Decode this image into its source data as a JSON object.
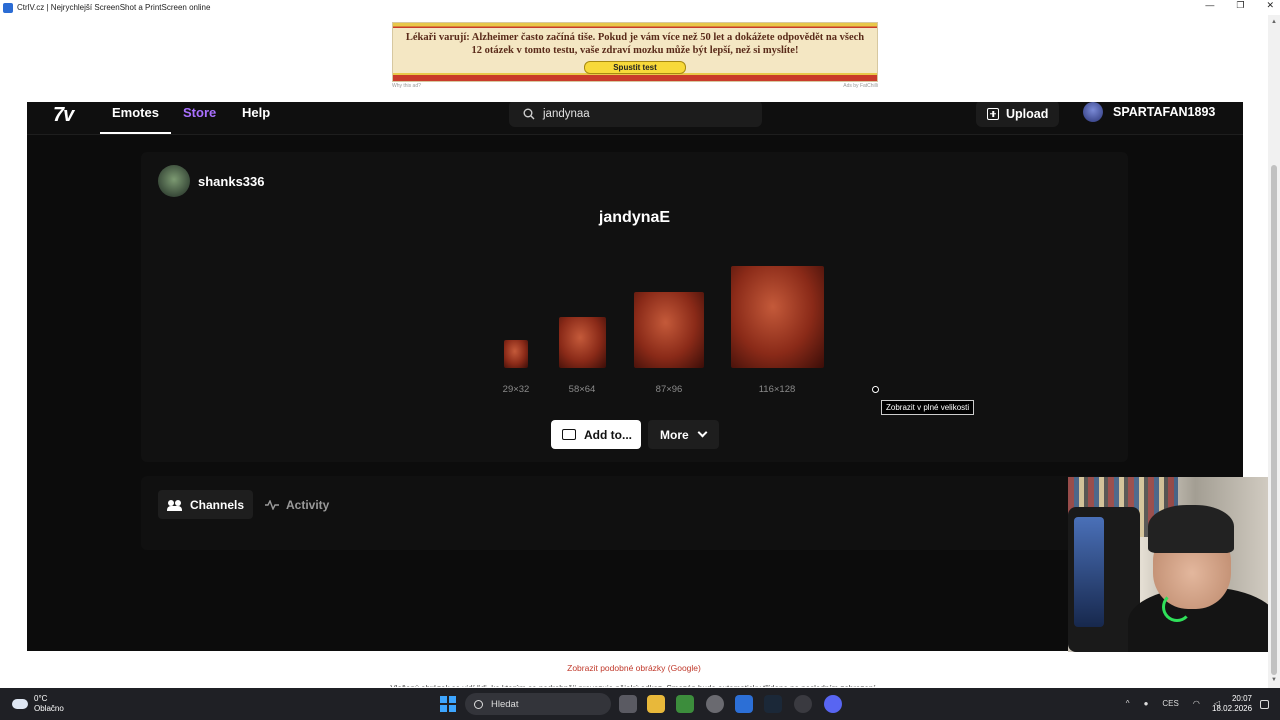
{
  "window": {
    "title": "CtrlV.cz | Nejrychlejší ScreenShot a PrintScreen online",
    "controls": [
      "—",
      "❐",
      "✕"
    ]
  },
  "ad": {
    "text": "Lékaři varují: Alzheimer často začíná tiše. Pokud je vám více než 50 let a dokážete odpovědět na všech 12 otázek v tomto testu, vaše zdraví mozku může být lepší, než si myslíte!",
    "button": "Spustit test",
    "why": "Why this ad?",
    "ads_by": "Ads by FatChilli"
  },
  "nav": {
    "logo": "7v",
    "links": [
      "Emotes",
      "Store",
      "Help"
    ],
    "active": "Emotes",
    "store_color": "#a970ff",
    "search_value": "jandynaa",
    "upload_label": "Upload",
    "username": "SPARTAFAN1893"
  },
  "emote": {
    "owner": "shanks336",
    "name": "jandynaE",
    "sizes": [
      "29×32",
      "58×64",
      "87×96",
      "116×128"
    ],
    "tooltip": "Zobrazit v plné velikosti",
    "add_label": "Add to...",
    "more_label": "More"
  },
  "tabs": {
    "channels": "Channels",
    "activity": "Activity"
  },
  "page": {
    "google_link": "Zobrazit podobné obrázky (Google)",
    "cut_text": "Vložený obrázek se vidí lidi, ke kterým se podrobněji provazuje nějaký odkaz. Smazán bude automaticky třídeno po posledním zobrazení."
  },
  "taskbar": {
    "temp": "0°C",
    "weather": "Oblačno",
    "search_placeholder": "Hledat",
    "lang": "CES",
    "time": "20:07",
    "date": "18.02.2026"
  }
}
